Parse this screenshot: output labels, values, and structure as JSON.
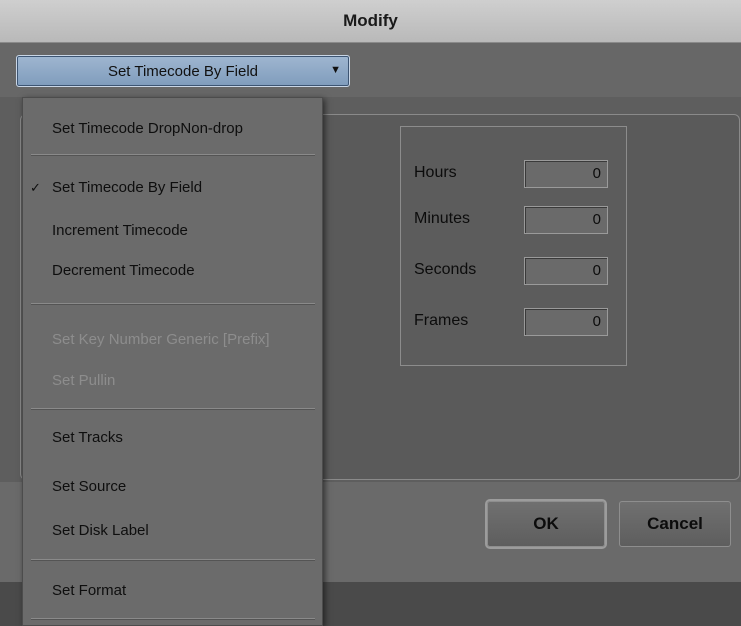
{
  "window": {
    "title": "Modify"
  },
  "mode_select": {
    "value": "Set Timecode By Field",
    "arrow_icon": "chevron-down-icon"
  },
  "menu": {
    "items": [
      {
        "label": "Set Timecode DropNon-drop",
        "enabled": true,
        "checked": false
      },
      {
        "label": "Set Timecode By Field",
        "enabled": true,
        "checked": true
      },
      {
        "label": "Increment Timecode",
        "enabled": true,
        "checked": false
      },
      {
        "label": "Decrement Timecode",
        "enabled": true,
        "checked": false
      },
      {
        "label": "Set Key Number Generic [Prefix]",
        "enabled": false,
        "checked": false
      },
      {
        "label": "Set Pullin",
        "enabled": false,
        "checked": false
      },
      {
        "label": "Set Tracks",
        "enabled": true,
        "checked": false
      },
      {
        "label": "Set Source",
        "enabled": true,
        "checked": false
      },
      {
        "label": "Set Disk Label",
        "enabled": true,
        "checked": false
      },
      {
        "label": "Set Format",
        "enabled": true,
        "checked": false
      }
    ],
    "check_mark": "✓"
  },
  "timecode": {
    "fields": [
      {
        "label": "Hours",
        "value": "0"
      },
      {
        "label": "Minutes",
        "value": "0"
      },
      {
        "label": "Seconds",
        "value": "0"
      },
      {
        "label": "Frames",
        "value": "0"
      }
    ]
  },
  "buttons": {
    "ok": "OK",
    "cancel": "Cancel"
  }
}
